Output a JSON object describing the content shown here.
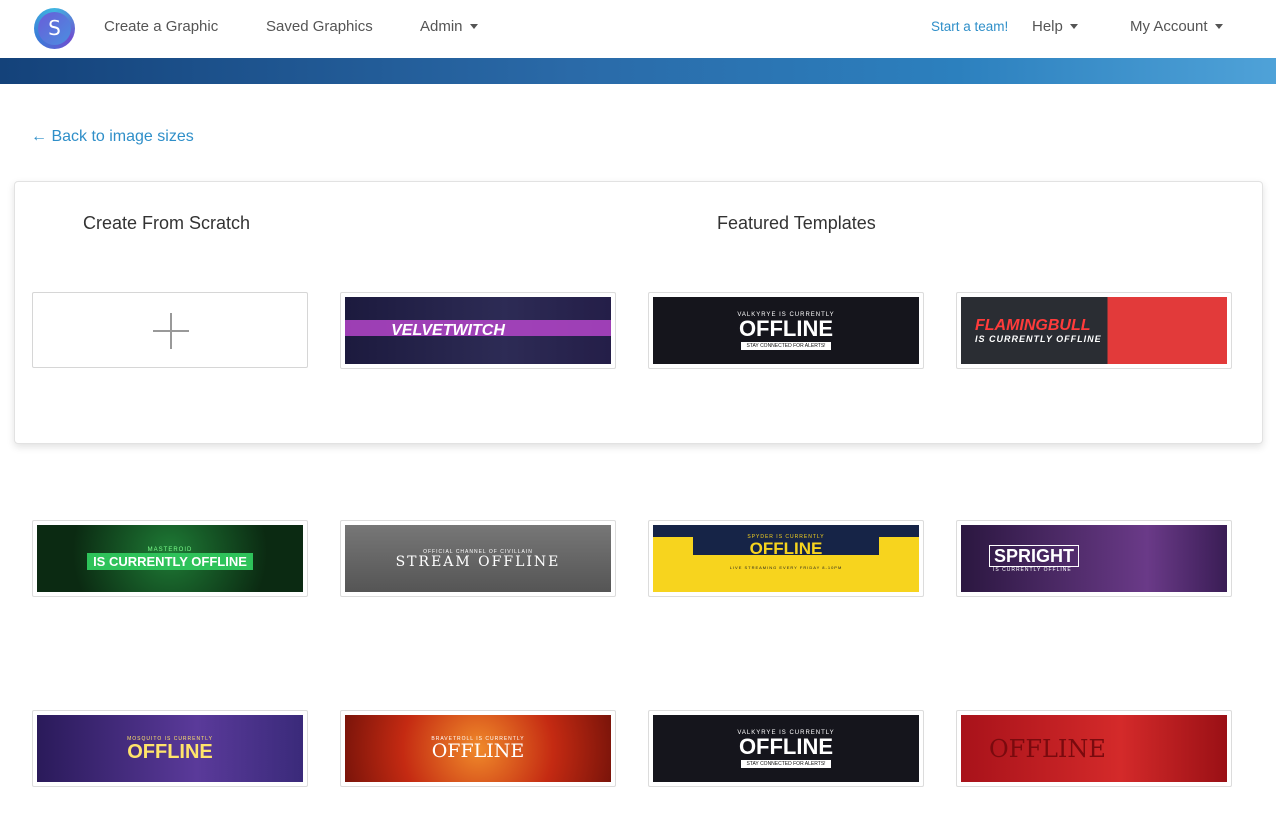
{
  "nav": {
    "logo_letter": "S",
    "create_label": "Create a Graphic",
    "saved_label": "Saved Graphics",
    "admin_label": "Admin",
    "team_label": "Start a team!",
    "help_label": "Help",
    "account_label": "My Account"
  },
  "back_label": "← Back to image sizes",
  "scratch_heading": "Create From Scratch",
  "featured_heading": "Featured Templates",
  "templates": [
    {
      "small": "",
      "big": "VELVETWITCH",
      "pill": ""
    },
    {
      "small": "VALKYRYE IS CURRENTLY",
      "big": "OFFLINE",
      "pill": "STAY CONNECTED FOR ALERTS!"
    },
    {
      "small": "",
      "big": "FLAMINGBULL",
      "pill": "IS CURRENTLY OFFLINE"
    },
    {
      "small": "MASTEROID",
      "big": "IS CURRENTLY OFFLINE",
      "pill": ""
    },
    {
      "small": "OFFICIAL CHANNEL OF CIVILLAIN",
      "big": "STREAM OFFLINE",
      "pill": ""
    },
    {
      "small": "SPYDER IS CURRENTLY",
      "big": "OFFLINE",
      "pill": "LIVE STREAMING EVERY FRIDAY 8-10PM"
    },
    {
      "small": "",
      "big": "SPRIGHT",
      "pill": "IS CURRENTLY OFFLINE"
    },
    {
      "small": "MOSQUITO IS CURRENTLY",
      "big": "OFFLINE",
      "pill": ""
    },
    {
      "small": "BRAVETROLL IS CURRENTLY",
      "big": "OFFLINE",
      "pill": ""
    },
    {
      "small": "VALKYRYE IS CURRENTLY",
      "big": "OFFLINE",
      "pill": "STAY CONNECTED FOR ALERTS!"
    },
    {
      "small": "",
      "big": "OFFLINE",
      "pill": ""
    }
  ]
}
